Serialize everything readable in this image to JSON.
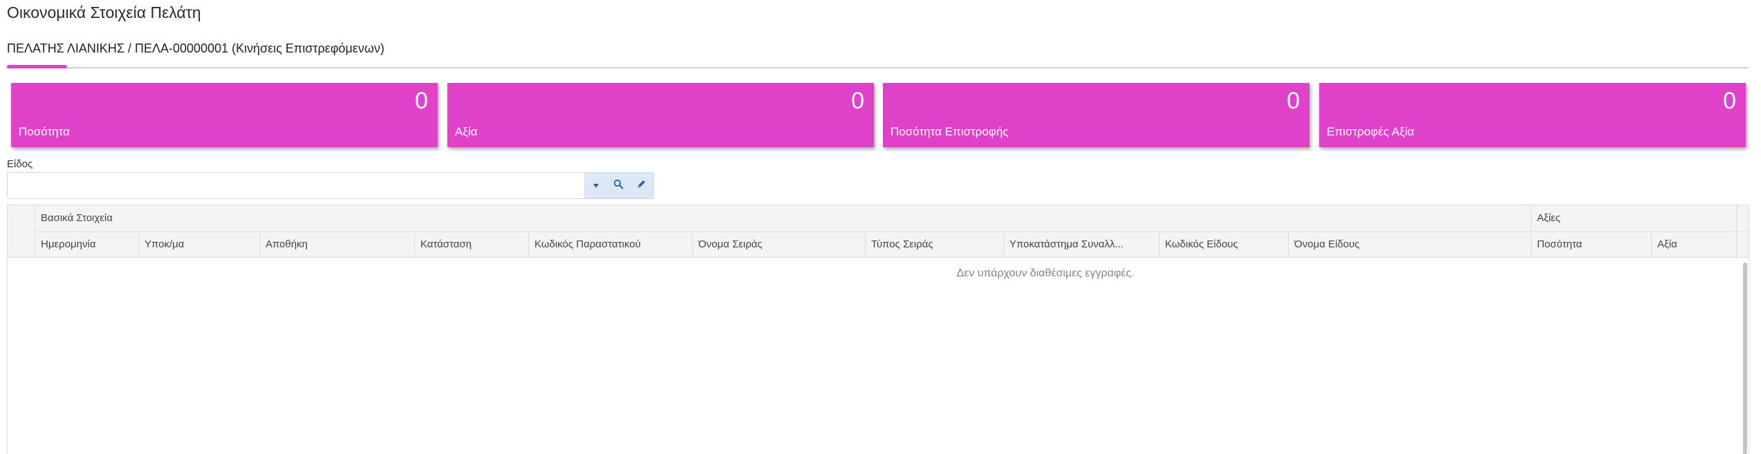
{
  "page": {
    "title": "Οικονομικά Στοιχεία Πελάτη"
  },
  "tab": {
    "label": "ΠΕΛΑΤΗΣ ΛΙΑΝΙΚΗΣ / ΠΕΛΑ-00000001 (Κινήσεις Επιστρεφόμενων)"
  },
  "cards": [
    {
      "value": "0",
      "label": "Ποσότητα"
    },
    {
      "value": "0",
      "label": "Αξία"
    },
    {
      "value": "0",
      "label": "Ποσότητα Επιστροφής"
    },
    {
      "value": "0",
      "label": "Επιστροφές Αξία"
    }
  ],
  "filter": {
    "label": "Είδος",
    "value": "",
    "buttons": [
      {
        "icon": "caret-down-icon"
      },
      {
        "icon": "search-icon"
      },
      {
        "icon": "pencil-icon"
      }
    ]
  },
  "grid": {
    "groups": [
      "Βασικά Στοιχεία",
      "Αξίες"
    ],
    "columns": [
      "Ημερομηνία",
      "Υποκ/μα",
      "Αποθήκη",
      "Κατάσταση",
      "Κωδικός Παραστατικού",
      "Όνομα Σειράς",
      "Τύπος Σειράς",
      "Υποκατάστημα Συναλλ...",
      "Κωδικός Είδους",
      "Όνομα Είδους",
      "Ποσότητα",
      "Αξία"
    ],
    "empty_message": "Δεν υπάρχουν διαθέσιμες εγγραφές."
  },
  "colors": {
    "accent": "#e041c9",
    "header_bg": "#f2f4f5",
    "button_bg": "#dce8f6",
    "icon": "#2c5f9c"
  }
}
